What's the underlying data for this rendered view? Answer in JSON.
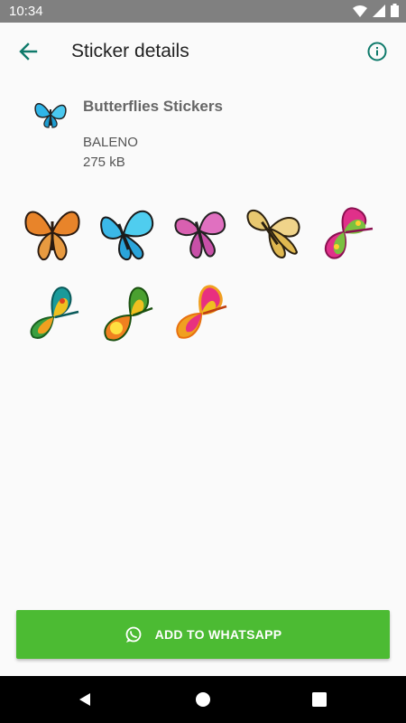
{
  "status": {
    "time": "10:34",
    "icons": [
      "wifi-icon",
      "signal-icon",
      "battery-icon"
    ]
  },
  "appbar": {
    "title": "Sticker details",
    "back_icon": "arrow-left-icon",
    "info_icon": "info-icon",
    "accent": "#0f7a6b"
  },
  "pack": {
    "name": "Butterflies Stickers",
    "publisher": "BALENO",
    "size": "275 kB"
  },
  "stickers": [
    {
      "name": "orange-monarch-butterfly"
    },
    {
      "name": "blue-butterfly"
    },
    {
      "name": "pink-butterfly"
    },
    {
      "name": "yellow-butterfly"
    },
    {
      "name": "magenta-green-butterfly"
    },
    {
      "name": "teal-yellow-butterfly"
    },
    {
      "name": "green-orange-butterfly"
    },
    {
      "name": "pink-orange-butterfly"
    }
  ],
  "action": {
    "label": "ADD TO WHATSAPP",
    "icon": "whatsapp-icon",
    "color": "#4cbb33"
  },
  "navbar": {
    "icons": [
      "nav-back-icon",
      "nav-home-icon",
      "nav-recents-icon"
    ]
  }
}
